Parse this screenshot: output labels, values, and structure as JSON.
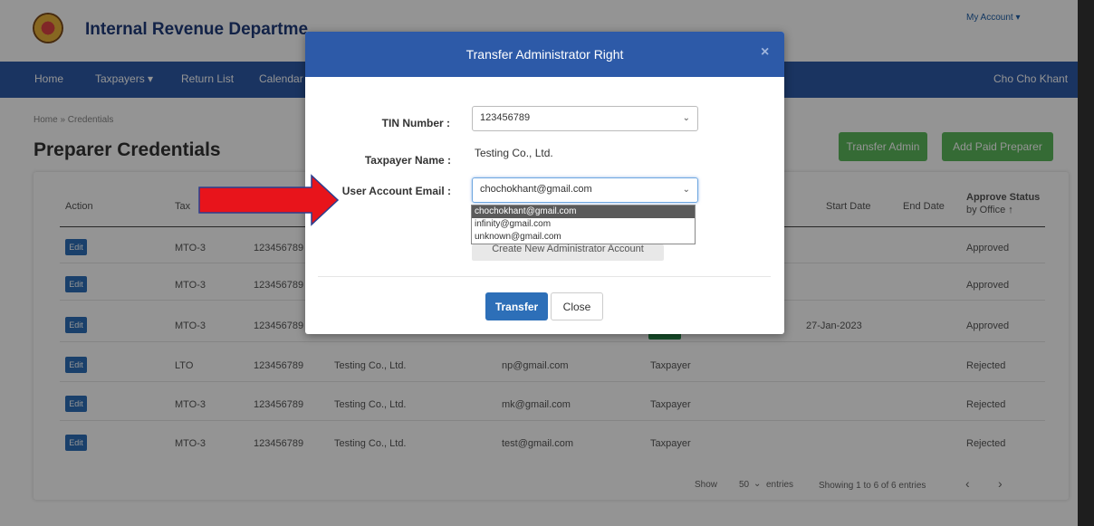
{
  "header": {
    "brand": "Internal Revenue Departme",
    "my_account": "My Account ▾",
    "logo_icon": "emblem-logo"
  },
  "nav": {
    "items": [
      "Home",
      "Taxpayers ▾",
      "Return List",
      "Calendar"
    ],
    "user_name": "Cho Cho Khant"
  },
  "breadcrumb": "Home » Credentials",
  "page_title": "Preparer Credentials",
  "buttons": {
    "transfer_admin": "Transfer Admin",
    "add_paid_preparer": "Add Paid Preparer"
  },
  "table": {
    "headers": {
      "action": "Action",
      "tax": "Tax",
      "start_date": "Start Date",
      "end_date": "End Date",
      "approve_status_line1": "Approve Status",
      "approve_status_line2": "by Office ↑"
    },
    "edit_label": "Edit",
    "rows": [
      {
        "tax_office": "MTO-3",
        "tin": "123456789",
        "name": "",
        "email": "",
        "type": "",
        "start": "",
        "end": "",
        "status": "Approved"
      },
      {
        "tax_office": "MTO-3",
        "tin": "123456789",
        "name": "",
        "email": "",
        "type": "",
        "start": "",
        "end": "",
        "status": "Approved"
      },
      {
        "tax_office": "MTO-3",
        "tin": "123456789",
        "name": "",
        "email": "",
        "type": "",
        "start": "27-Jan-2023",
        "end": "",
        "status": "Approved"
      },
      {
        "tax_office": "LTO",
        "tin": "123456789",
        "name": "Testing Co., Ltd.",
        "email": "np@gmail.com",
        "type": "Taxpayer",
        "start": "",
        "end": "",
        "status": "Rejected"
      },
      {
        "tax_office": "MTO-3",
        "tin": "123456789",
        "name": "Testing Co., Ltd.",
        "email": "mk@gmail.com",
        "type": "Taxpayer",
        "start": "",
        "end": "",
        "status": "Rejected"
      },
      {
        "tax_office": "MTO-3",
        "tin": "123456789",
        "name": "Testing Co., Ltd.",
        "email": "test@gmail.com",
        "type": "Taxpayer",
        "start": "",
        "end": "",
        "status": "Rejected"
      }
    ]
  },
  "pager": {
    "show_label": "Show",
    "page_size": "50",
    "entries_label": "entries",
    "showing": "Showing 1 to 6 of 6 entries",
    "prev": "‹",
    "next": "›"
  },
  "modal": {
    "title": "Transfer Administrator Right",
    "close_icon": "×",
    "tin_label": "TIN Number :",
    "tin_value": "123456789",
    "taxpayer_label": "Taxpayer Name :",
    "taxpayer_value": "Testing Co., Ltd.",
    "email_label": "User Account Email :",
    "email_value": "chochokhant@gmail.com",
    "email_options": [
      "chochokhant@gmail.com",
      "infinity@gmail.com",
      "unknown@gmail.com"
    ],
    "create_new": "Create New Administrator Account",
    "transfer": "Transfer",
    "close": "Close"
  },
  "colors": {
    "primary": "#2d5aa8",
    "success": "#5cb85c",
    "arrow": "#e8141b"
  }
}
